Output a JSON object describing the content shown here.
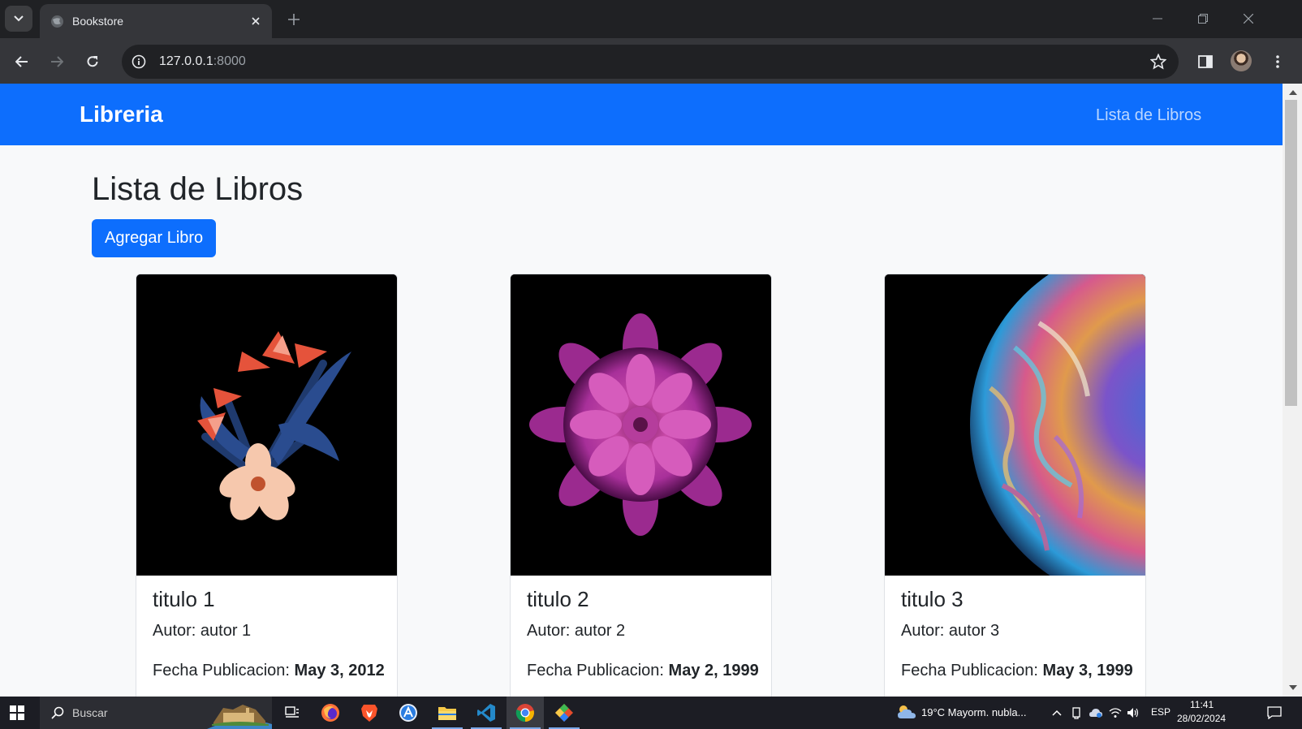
{
  "browser": {
    "tab_title": "Bookstore",
    "url_host": "127.0.0.1",
    "url_port": ":8000"
  },
  "navbar": {
    "brand": "Libreria",
    "link": "Lista de Libros"
  },
  "page": {
    "heading": "Lista de Libros",
    "add_button": "Agregar Libro"
  },
  "books": [
    {
      "title": "titulo 1",
      "author": "Autor: autor 1",
      "date_label": "Fecha Publicacion:",
      "date": "May 3, 2012",
      "image": "tropical-flowers-image"
    },
    {
      "title": "titulo 2",
      "author": "Autor: autor 2",
      "date_label": "Fecha Publicacion:",
      "date": "May 2, 1999",
      "image": "pink-dahlia-image"
    },
    {
      "title": "titulo 3",
      "author": "Autor: autor 3",
      "date_label": "Fecha Publicacion:",
      "date": "May 3, 1999",
      "image": "planet-bubble-image"
    }
  ],
  "taskbar": {
    "search_text": "Buscar",
    "weather": "19°C  Mayorm. nubla...",
    "language": "ESP",
    "time": "11:41",
    "date": "28/02/2024"
  },
  "colors": {
    "primary": "#0d6efd",
    "page_bg": "#f8f9fa",
    "chrome_dark": "#202124",
    "chrome_toolbar": "#35363a"
  }
}
